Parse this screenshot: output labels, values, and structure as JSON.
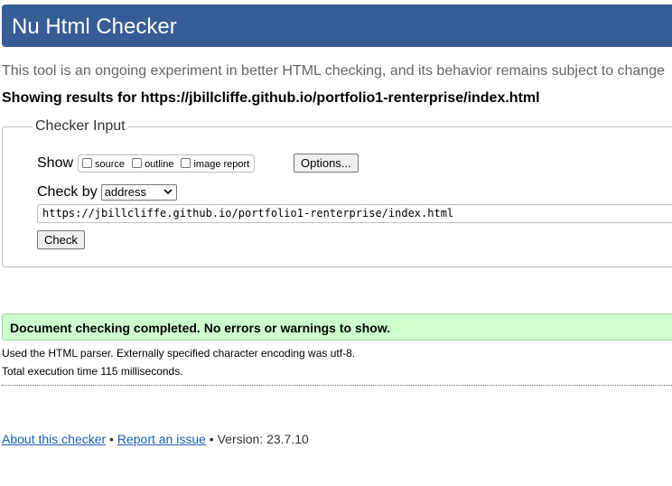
{
  "header": {
    "title": "Nu Html Checker"
  },
  "intro": "This tool is an ongoing experiment in better HTML checking, and its behavior remains subject to change",
  "results_for": "Showing results for https://jbillcliffe.github.io/portfolio1-renterprise/index.html",
  "checker_input": {
    "legend": "Checker Input",
    "show_label": "Show",
    "options": [
      {
        "label": "source",
        "checked": false
      },
      {
        "label": "outline",
        "checked": false
      },
      {
        "label": "image report",
        "checked": false
      }
    ],
    "options_button": "Options...",
    "check_by_label": "Check by",
    "check_by_value": "address",
    "url_value": "https://jbillcliffe.github.io/portfolio1-renterprise/index.html",
    "check_button": "Check"
  },
  "result": {
    "message": "Document checking completed. No errors or warnings to show.",
    "color": "#ccffcc"
  },
  "details": {
    "parser": "Used the HTML parser. Externally specified character encoding was utf-8.",
    "time": "Total execution time 115 milliseconds."
  },
  "footer": {
    "about_link": "About this checker",
    "sep1": " • ",
    "report_link": "Report an issue",
    "version": " • Version: 23.7.10"
  },
  "colors": {
    "header_bg": "#365d95",
    "success_bg": "#ccffcc"
  }
}
